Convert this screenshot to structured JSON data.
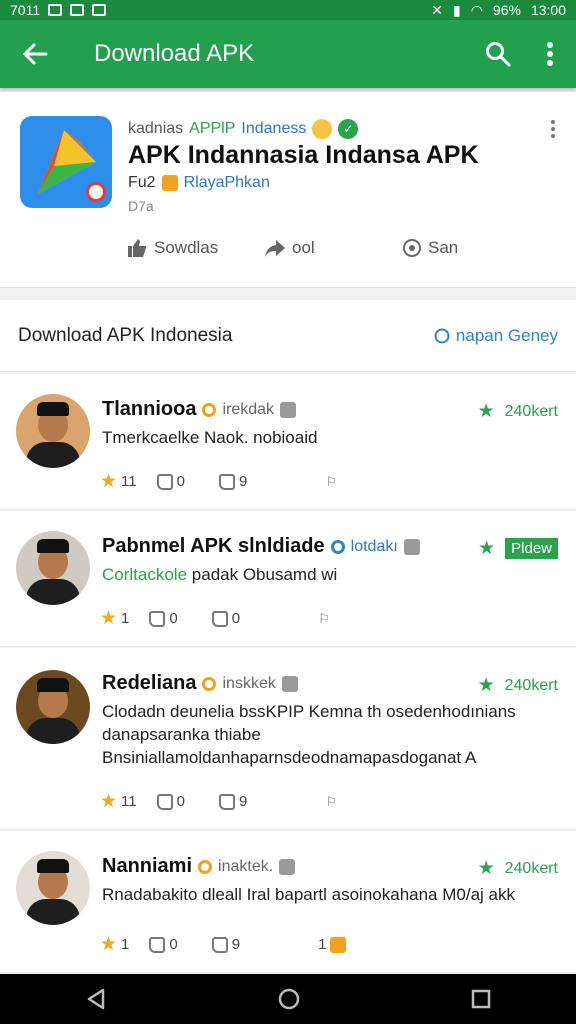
{
  "status_bar": {
    "left_text": "7011",
    "battery": "96%",
    "time": "13:00"
  },
  "app_bar": {
    "title": "Download APK"
  },
  "app_card": {
    "developer_prefix": "kadnias",
    "developer_brand": "APPlP",
    "developer_suffix": "Indaness",
    "name": "APK Indannasia Indansa APK",
    "sub_prefix": "Fu2",
    "sub_link": "RlayaPhkan",
    "size": "D7a",
    "actions": [
      {
        "icon": "thumbs-up-icon",
        "label": "Sowdlas"
      },
      {
        "icon": "share-icon",
        "label": "ool"
      },
      {
        "icon": "save-icon",
        "label": "San"
      }
    ]
  },
  "section": {
    "title": "Download APK Indonesia",
    "link": "napan Geney"
  },
  "reviews": [
    {
      "name": "Tlanniooa",
      "tag": "irekdak",
      "score": "240kert",
      "score_style": "text",
      "text": "Tmerkcaelke Naok. nobioaid",
      "highlight": "",
      "rating": "11",
      "likes": "0",
      "dislikes": "9",
      "extra": "",
      "avatar_bg": "#d9a46d"
    },
    {
      "name": "Pabnmel APK slnldiade",
      "tag": "lotdakı",
      "score": "Pldew",
      "score_style": "pill",
      "text": "padak Obusamd wi",
      "highlight": "Corltackole",
      "rating": "1",
      "likes": "0",
      "dislikes": "0",
      "extra": "",
      "avatar_bg": "#cfcac2"
    },
    {
      "name": "Redeliana",
      "tag": "inskkek",
      "score": "240kert",
      "score_style": "text",
      "text": "Clodadn deunelia bssKPIP Kemna th osedenhodınians danapsaranka thiabe Bnsiniallamoldanhaparnsdeodnamapasdoganat A",
      "highlight": "",
      "rating": "11",
      "likes": "0",
      "dislikes": "9",
      "extra": "",
      "avatar_bg": "#6b4a22"
    },
    {
      "name": "Nanniami",
      "tag": "inaktek.",
      "score": "240kert",
      "score_style": "text",
      "text": "Rnadabakito dleall Iral bapartl asoinokahana M0/aj akk",
      "highlight": "",
      "rating": "1",
      "likes": "0",
      "dislikes": "9",
      "extra": "1",
      "avatar_bg": "#e2ddd6"
    }
  ]
}
